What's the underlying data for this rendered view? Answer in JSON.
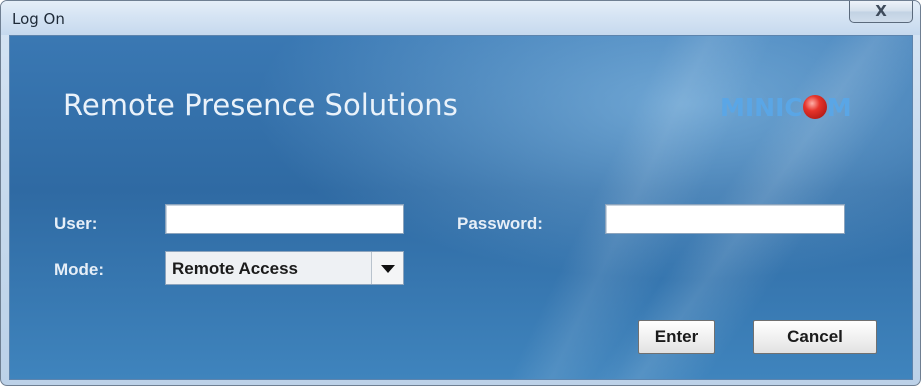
{
  "window": {
    "title": "Log On",
    "close_label": "X"
  },
  "branding": {
    "app_title": "Remote Presence Solutions",
    "logo_left": "MINIC",
    "logo_right": "M",
    "logo_text": "MINICOM"
  },
  "form": {
    "user_label": "User:",
    "user_value": "",
    "password_label": "Password:",
    "password_value": "",
    "mode_label": "Mode:",
    "mode_value": "Remote Access"
  },
  "buttons": {
    "enter_label": "Enter",
    "cancel_label": "Cancel"
  },
  "colors": {
    "panel_blue": "#2f6aa3",
    "logo_blue": "#5aa6e6",
    "logo_ball_red": "#e6332a"
  }
}
